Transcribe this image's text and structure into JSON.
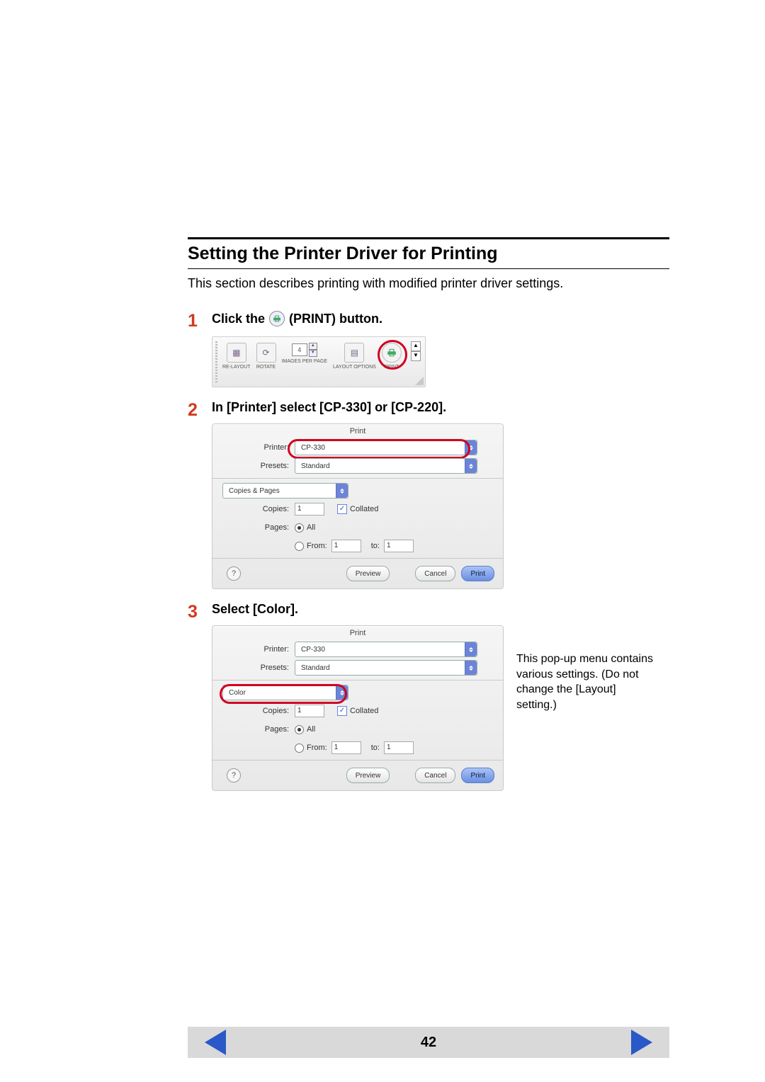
{
  "heading": "Setting the Printer Driver for Printing",
  "intro": "This section describes printing with modified printer driver settings.",
  "steps": {
    "s1": {
      "num": "1",
      "pre": "Click the ",
      "post": " (PRINT) button."
    },
    "s2": {
      "num": "2",
      "title": "In [Printer] select [CP-330] or [CP-220]."
    },
    "s3": {
      "num": "3",
      "title": "Select [Color]."
    }
  },
  "toolbar": {
    "images_value": "4",
    "items": {
      "relayout": "RE-LAYOUT",
      "rotate": "ROTATE",
      "images": "IMAGES PER PAGE",
      "layout": "LAYOUT OPTIONS",
      "print": "PRINT"
    }
  },
  "dialog": {
    "title": "Print",
    "printer_label": "Printer:",
    "printer_value": "CP-330",
    "presets_label": "Presets:",
    "presets_value": "Standard",
    "panel2_value": "Copies & Pages",
    "panel3_value": "Color",
    "copies_label": "Copies:",
    "copies_value": "1",
    "collated_label": "Collated",
    "pages_label": "Pages:",
    "pages_all": "All",
    "pages_from": "From:",
    "from_value": "1",
    "pages_to": "to:",
    "to_value": "1",
    "help": "?",
    "preview_btn": "Preview",
    "cancel_btn": "Cancel",
    "print_btn": "Print"
  },
  "note": "This pop-up menu contains various settings. (Do not change the [Layout] setting.)",
  "page_number": "42"
}
